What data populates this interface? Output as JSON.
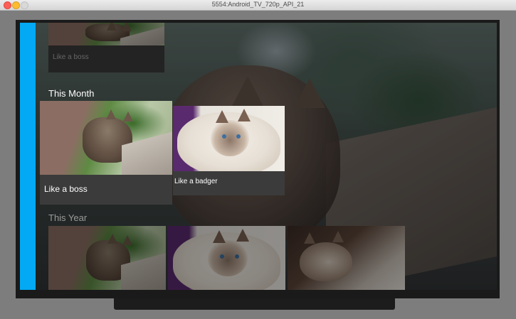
{
  "window": {
    "title": "5554:Android_TV_720p_API_21"
  },
  "rows": {
    "top_card": {
      "label": "Like a boss"
    },
    "this_month": {
      "title": "This Month",
      "cards": [
        {
          "label": "Like a boss",
          "image": "cat-walking-on-fence"
        },
        {
          "label": "Like a badger",
          "image": "fluffy-white-cat"
        }
      ]
    },
    "this_year": {
      "title": "This Year",
      "cards": [
        {
          "image": "cat-walking-on-fence"
        },
        {
          "image": "fluffy-white-cat"
        },
        {
          "image": "tabby-cat"
        }
      ]
    }
  },
  "colors": {
    "accent_strip": "#03a9f4",
    "card_info_bg": "#3b3b3b"
  }
}
